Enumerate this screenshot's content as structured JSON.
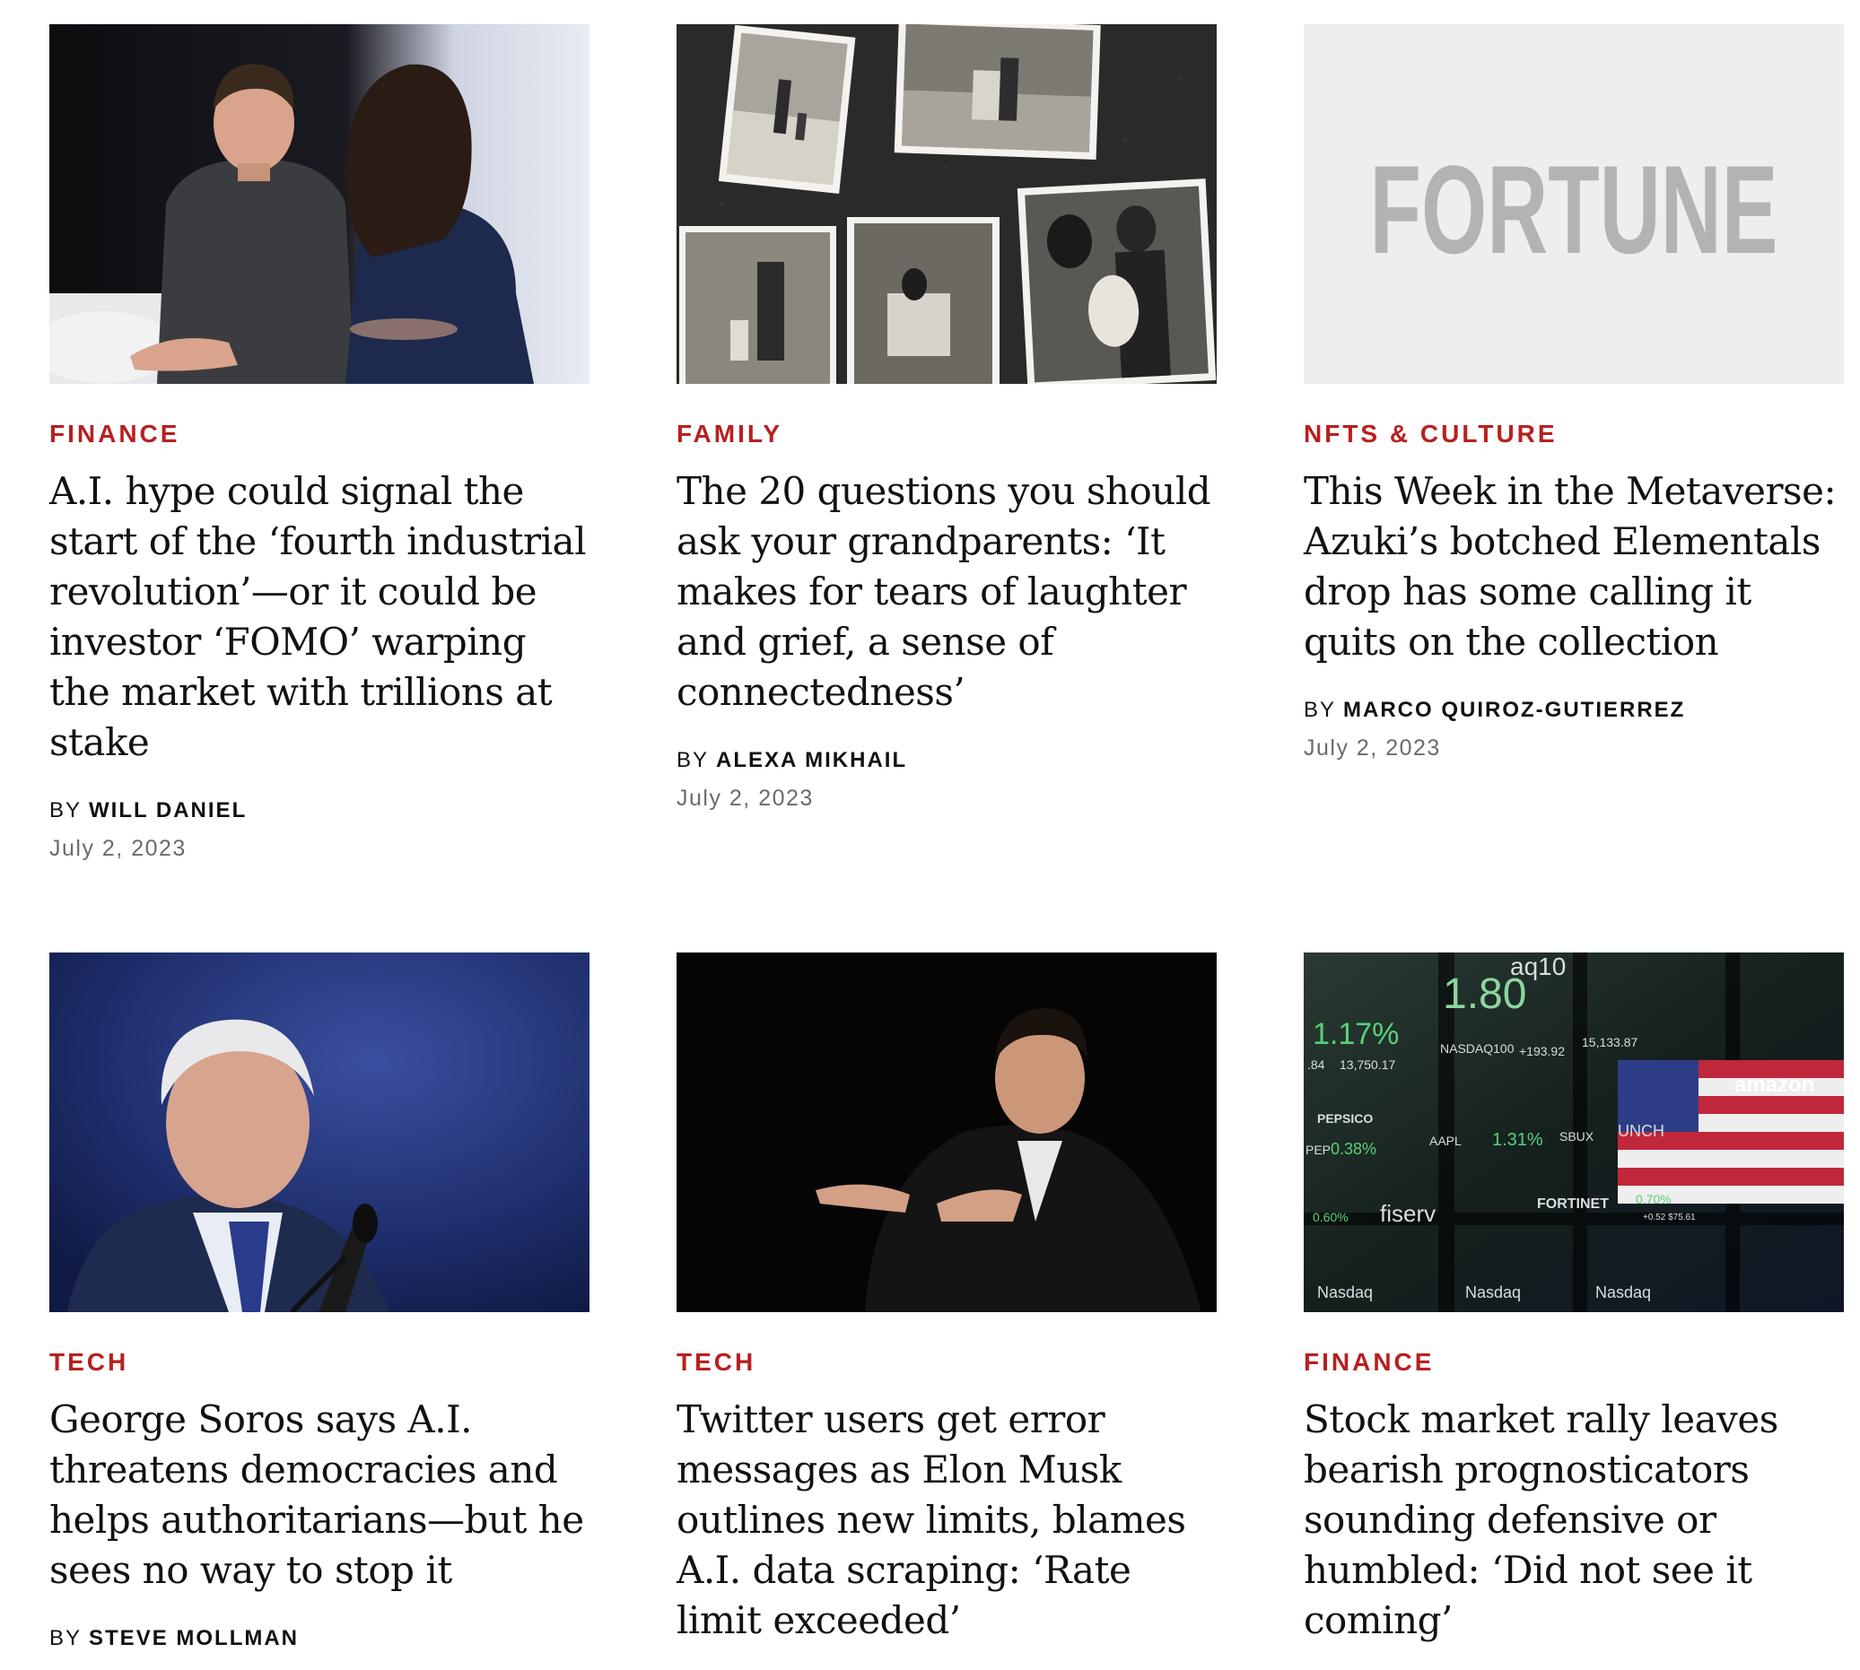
{
  "articles": [
    {
      "category": "FINANCE",
      "headline": "A.I. hype could signal the start of the ‘fourth industrial revolution’—or it could be investor ‘FOMO’ warping the market with trillions at stake",
      "by": "BY",
      "author": "WILL DANIEL",
      "date": "July 2, 2023"
    },
    {
      "category": "FAMILY",
      "headline": "The 20 questions you should ask your grandparents: ‘It makes for tears of laughter and grief, a sense of connectedness’",
      "by": "BY",
      "author": "ALEXA MIKHAIL",
      "date": "July 2, 2023"
    },
    {
      "category": "NFTS & CULTURE",
      "headline": "This Week in the Metaverse: Azuki’s botched Elementals drop has some calling it quits on the collection",
      "by": "BY",
      "author": "MARCO QUIROZ-GUTIERREZ",
      "date": "July 2, 2023",
      "placeholder_logo": "FORTUNE"
    },
    {
      "category": "TECH",
      "headline": "George Soros says A.I. threatens democracies and helps authoritarians—but he sees no way to stop it",
      "by": "BY",
      "author": "STEVE MOLLMAN"
    },
    {
      "category": "TECH",
      "headline": "Twitter users get error messages as Elon Musk outlines new limits, blames A.I. data scraping: ‘Rate limit exceeded’"
    },
    {
      "category": "FINANCE",
      "headline": "Stock market rally leaves bearish prognosticators sounding defensive or humbled: ‘Did not see it coming’",
      "ticker": {
        "t1": "1.17%",
        "t2": "NASDAQ100",
        "t3": "13,750.17",
        "t4": "1.80",
        "t5": "+193.92",
        "t6": "15,133.87",
        "t7": "PEPSICO",
        "t8": "PEP",
        "t9": "0.38%",
        "t10": "AAPL",
        "t11": "1.31%",
        "t12": "SBUX",
        "t13": "UNCH",
        "t14": "amazon",
        "t15": "0.60%",
        "t16": "fiserv",
        "t17": "FORTINET",
        "t18": "0.70%",
        "t19": "+0.52 $75.61",
        "t20": "Nasdaq",
        "t21": "Nasdaq",
        "t22": "Nasdaq",
        "t23": ".84",
        "t24": "aq10"
      }
    }
  ],
  "colors": {
    "category": "#b8201f",
    "headline": "#111111",
    "date": "#6b6b6b",
    "placeholder_bg": "#eeeeee",
    "placeholder_logo": "#b3b3b3"
  }
}
